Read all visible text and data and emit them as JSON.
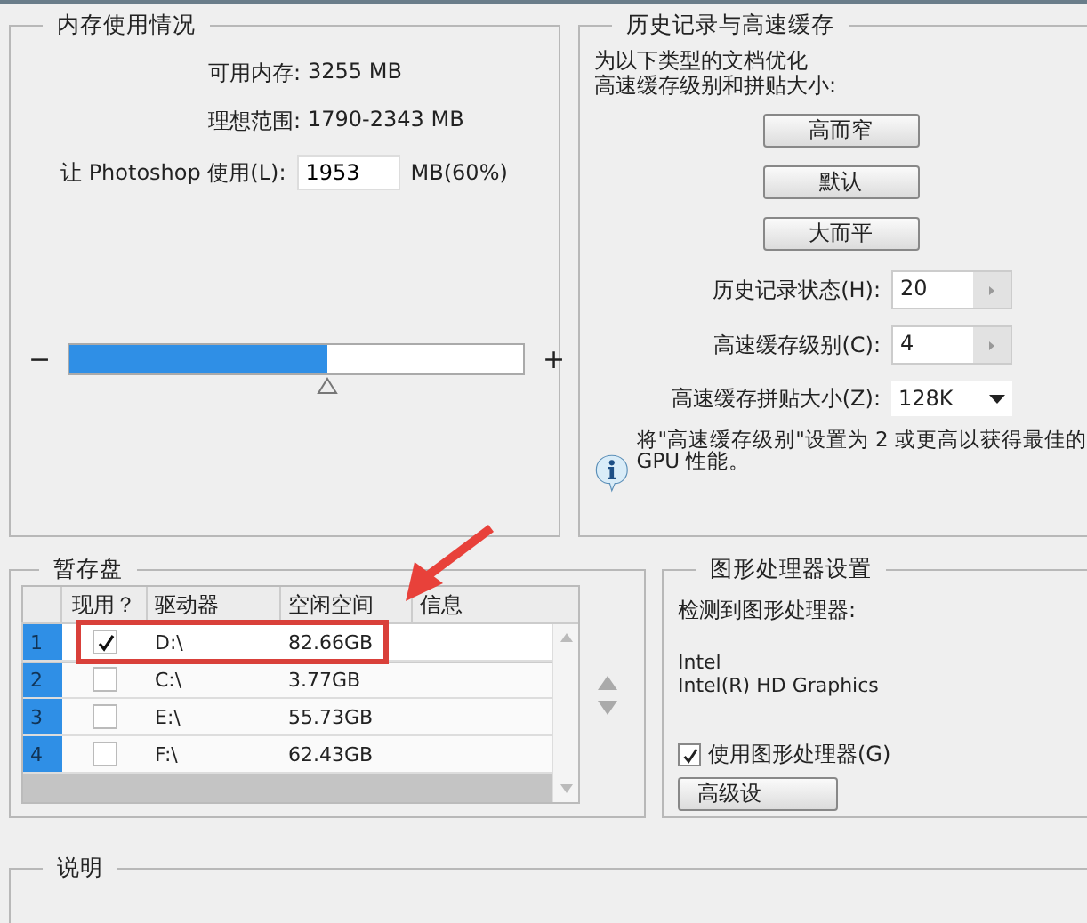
{
  "memory": {
    "title": "内存使用情况",
    "available_label": "可用内存:",
    "available_value": "3255 MB",
    "ideal_label": "理想范围:",
    "ideal_value": "1790-2343 MB",
    "use_label": "让 Photoshop 使用(L):",
    "use_value": "1953",
    "use_unit": "MB(60%)",
    "minus": "−",
    "plus": "+",
    "level": 0.57
  },
  "history": {
    "title": "历史记录与高速缓存",
    "intro": [
      "为以下类型的文档优化",
      "高速缓存级别和拼贴大小:"
    ],
    "buttons": [
      "高而窄",
      "默认",
      "大而平"
    ],
    "fields": [
      {
        "kind": "stepper",
        "label": "历史记录状态(H):",
        "value": "20"
      },
      {
        "kind": "stepper",
        "label": "高速缓存级别(C):",
        "value": "4"
      },
      {
        "kind": "dropdown",
        "label": "高速缓存拼贴大小(Z):",
        "value": "128K"
      }
    ],
    "info": [
      "将\"高速缓存级别\"设置为 2 或更高以获得最佳的",
      "GPU 性能。"
    ]
  },
  "scratch": {
    "title": "暂存盘",
    "columns": [
      "现用？",
      "驱动器",
      "空闲空间",
      "信息"
    ],
    "rows": [
      {
        "index": "1",
        "checked": true,
        "drive": "D:\\",
        "free": "82.66GB",
        "selected": true
      },
      {
        "index": "2",
        "checked": false,
        "drive": "C:\\",
        "free": "3.77GB",
        "selected": false
      },
      {
        "index": "3",
        "checked": false,
        "drive": "E:\\",
        "free": "55.73GB",
        "selected": false
      },
      {
        "index": "4",
        "checked": false,
        "drive": "F:\\",
        "free": "62.43GB",
        "selected": false
      }
    ]
  },
  "gpu": {
    "title": "图形处理器设置",
    "detected_label": "检测到图形处理器:",
    "vendor": "Intel",
    "model": "Intel(R) HD Graphics",
    "use_gpu": {
      "label": "使用图形处理器(G)",
      "checked": true
    },
    "advanced_button": "高级设"
  },
  "description": {
    "title": "说明"
  }
}
